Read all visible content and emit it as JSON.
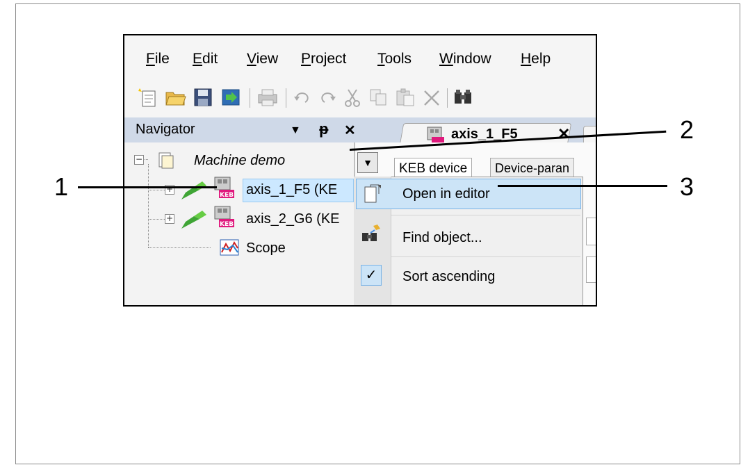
{
  "menu": {
    "file": "File",
    "edit": "Edit",
    "view": "View",
    "project": "Project",
    "tools": "Tools",
    "window": "Window",
    "help": "Help"
  },
  "toolbar": {
    "icons": [
      "new-file-icon",
      "open-folder-icon",
      "save-icon",
      "import-icon",
      "print-icon",
      "undo-icon",
      "redo-icon",
      "cut-icon",
      "copy-icon",
      "paste-icon",
      "delete-icon",
      "find-icon"
    ]
  },
  "navigator": {
    "title": "Navigator",
    "dropdown_glyph": "▼",
    "pin_glyph": "ᵽ",
    "close_glyph": "✕",
    "tree": {
      "root": "Machine demo",
      "items": [
        "axis_1_F5 (KE",
        "axis_2_G6 (KE",
        "Scope"
      ]
    }
  },
  "editor": {
    "tab_label": "axis_1_F5",
    "tab_close": "✕",
    "subtabs": [
      "KEB device",
      "Device-paran"
    ]
  },
  "context_menu": {
    "items": [
      "Open in editor",
      "Find object...",
      "Sort ascending"
    ],
    "check_glyph": "✓"
  },
  "callouts": [
    "1",
    "2",
    "3"
  ],
  "colors": {
    "nav_header": "#cfd9e8",
    "highlight": "#cce4f7",
    "highlight_border": "#7ab3e6"
  }
}
